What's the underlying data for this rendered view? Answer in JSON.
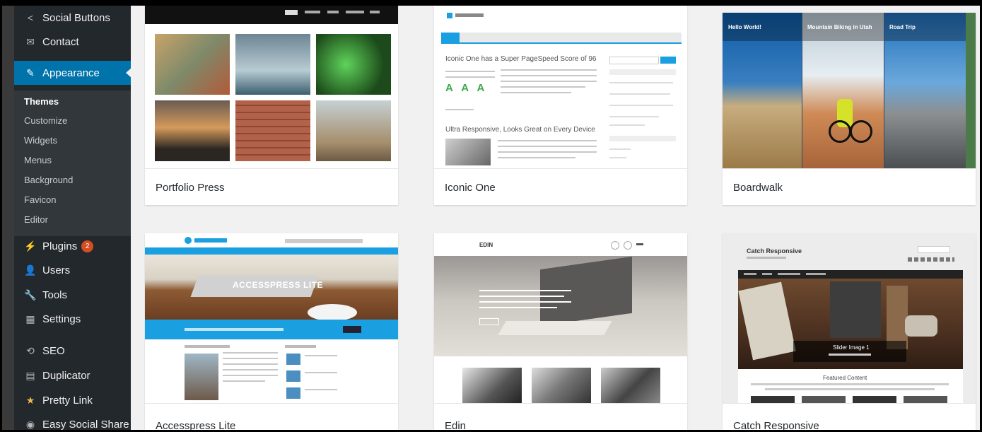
{
  "sidebar": {
    "items": [
      {
        "label": "Social Buttons",
        "icon": "share-icon"
      },
      {
        "label": "Contact",
        "icon": "envelope-icon"
      },
      {
        "label": "Appearance",
        "icon": "paintbrush-icon",
        "active": true
      },
      {
        "label": "Plugins",
        "icon": "plug-icon",
        "badge": "2"
      },
      {
        "label": "Users",
        "icon": "users-icon"
      },
      {
        "label": "Tools",
        "icon": "wrench-icon"
      },
      {
        "label": "Settings",
        "icon": "sliders-icon"
      },
      {
        "label": "SEO",
        "icon": "seo-icon"
      },
      {
        "label": "Duplicator",
        "icon": "duplicator-icon"
      },
      {
        "label": "Pretty Link",
        "icon": "star-icon"
      },
      {
        "label": "Easy Social Share",
        "icon": "share-circle-icon"
      }
    ],
    "submenu": [
      "Themes",
      "Customize",
      "Widgets",
      "Menus",
      "Background",
      "Favicon",
      "Editor"
    ],
    "current_submenu": "Themes"
  },
  "themes": [
    {
      "name": "Portfolio Press"
    },
    {
      "name": "Iconic One"
    },
    {
      "name": "Boardwalk"
    },
    {
      "name": "Accesspress Lite"
    },
    {
      "name": "Edin"
    },
    {
      "name": "Catch Responsive"
    }
  ],
  "previews": {
    "iconic": {
      "post1": "Iconic One has a Super PageSpeed Score of 96",
      "post2": "Ultra Responsive, Looks Great on Every Device"
    },
    "boardwalk": {
      "panel1": "Hello World!",
      "panel2": "Mountain Biking in Utah",
      "panel3": "Road Trip"
    },
    "accesspress": {
      "hero": "ACCESSPRESS LITE"
    },
    "edin": {
      "logo": "EDIN"
    },
    "catch": {
      "title": "Catch Responsive",
      "slider": "Slider Image 1",
      "featured": "Featured Content"
    }
  },
  "colors": {
    "sidebar_bg": "#23282d",
    "submenu_bg": "#32373c",
    "accent": "#0073aa",
    "badge": "#d54e21",
    "page_bg": "#f1f1f1"
  }
}
